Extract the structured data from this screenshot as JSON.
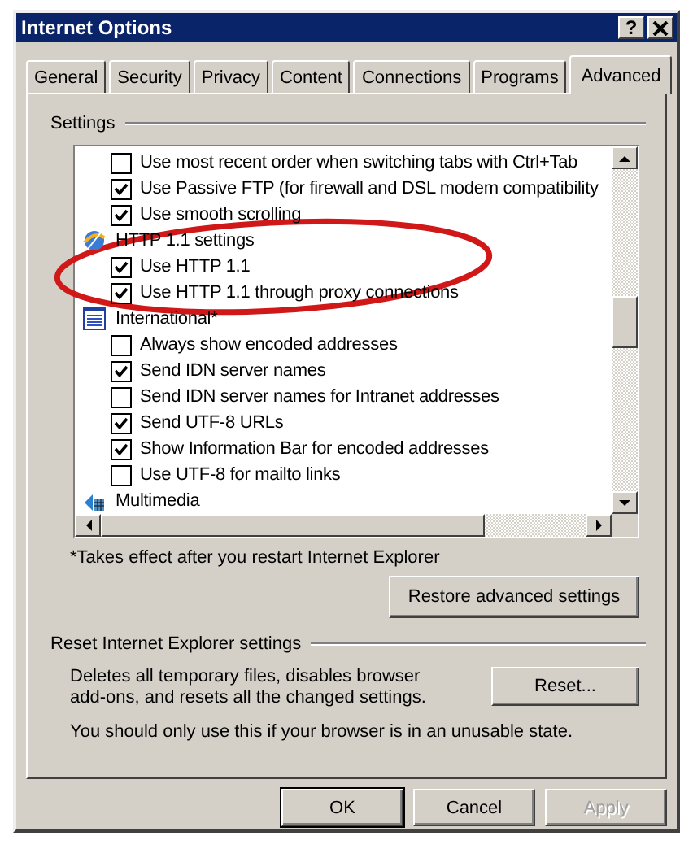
{
  "window": {
    "title": "Internet Options",
    "help_button": "?"
  },
  "tabs": [
    {
      "label": "General",
      "selected": false
    },
    {
      "label": "Security",
      "selected": false
    },
    {
      "label": "Privacy",
      "selected": false
    },
    {
      "label": "Content",
      "selected": false
    },
    {
      "label": "Connections",
      "selected": false
    },
    {
      "label": "Programs",
      "selected": false
    },
    {
      "label": "Advanced",
      "selected": true
    }
  ],
  "settings": {
    "title": "Settings",
    "items": [
      {
        "kind": "checkbox",
        "label": "Use most recent order when switching tabs with Ctrl+Tab",
        "checked": false
      },
      {
        "kind": "checkbox",
        "label": "Use Passive FTP (for firewall and DSL modem compatibility",
        "checked": true
      },
      {
        "kind": "checkbox",
        "label": "Use smooth scrolling",
        "checked": true
      },
      {
        "kind": "category",
        "label": "HTTP 1.1 settings",
        "children": [
          {
            "kind": "checkbox",
            "label": "Use HTTP 1.1",
            "checked": true
          },
          {
            "kind": "checkbox",
            "label": "Use HTTP 1.1 through proxy connections",
            "checked": true
          }
        ]
      },
      {
        "kind": "category",
        "label": "International*",
        "children": [
          {
            "kind": "checkbox",
            "label": "Always show encoded addresses",
            "checked": false
          },
          {
            "kind": "checkbox",
            "label": "Send IDN server names",
            "checked": true
          },
          {
            "kind": "checkbox",
            "label": "Send IDN server names for Intranet addresses",
            "checked": false
          },
          {
            "kind": "checkbox",
            "label": "Send UTF-8 URLs",
            "checked": true
          },
          {
            "kind": "checkbox",
            "label": "Show Information Bar for encoded addresses",
            "checked": true
          },
          {
            "kind": "checkbox",
            "label": "Use UTF-8 for mailto links",
            "checked": false
          }
        ]
      },
      {
        "kind": "category",
        "label": "Multimedia"
      }
    ],
    "note": "*Takes effect after you restart Internet Explorer",
    "restore_button": "Restore advanced settings"
  },
  "reset": {
    "title": "Reset Internet Explorer settings",
    "description": "Deletes all temporary files, disables browser add-ons, and resets all the changed settings.",
    "button": "Reset...",
    "warning": "You should only use this if your browser is in an unusable state."
  },
  "buttons": [
    {
      "label": "OK",
      "default": true,
      "disabled": false
    },
    {
      "label": "Cancel",
      "default": false,
      "disabled": false
    },
    {
      "label": "Apply",
      "default": false,
      "disabled": true
    }
  ]
}
